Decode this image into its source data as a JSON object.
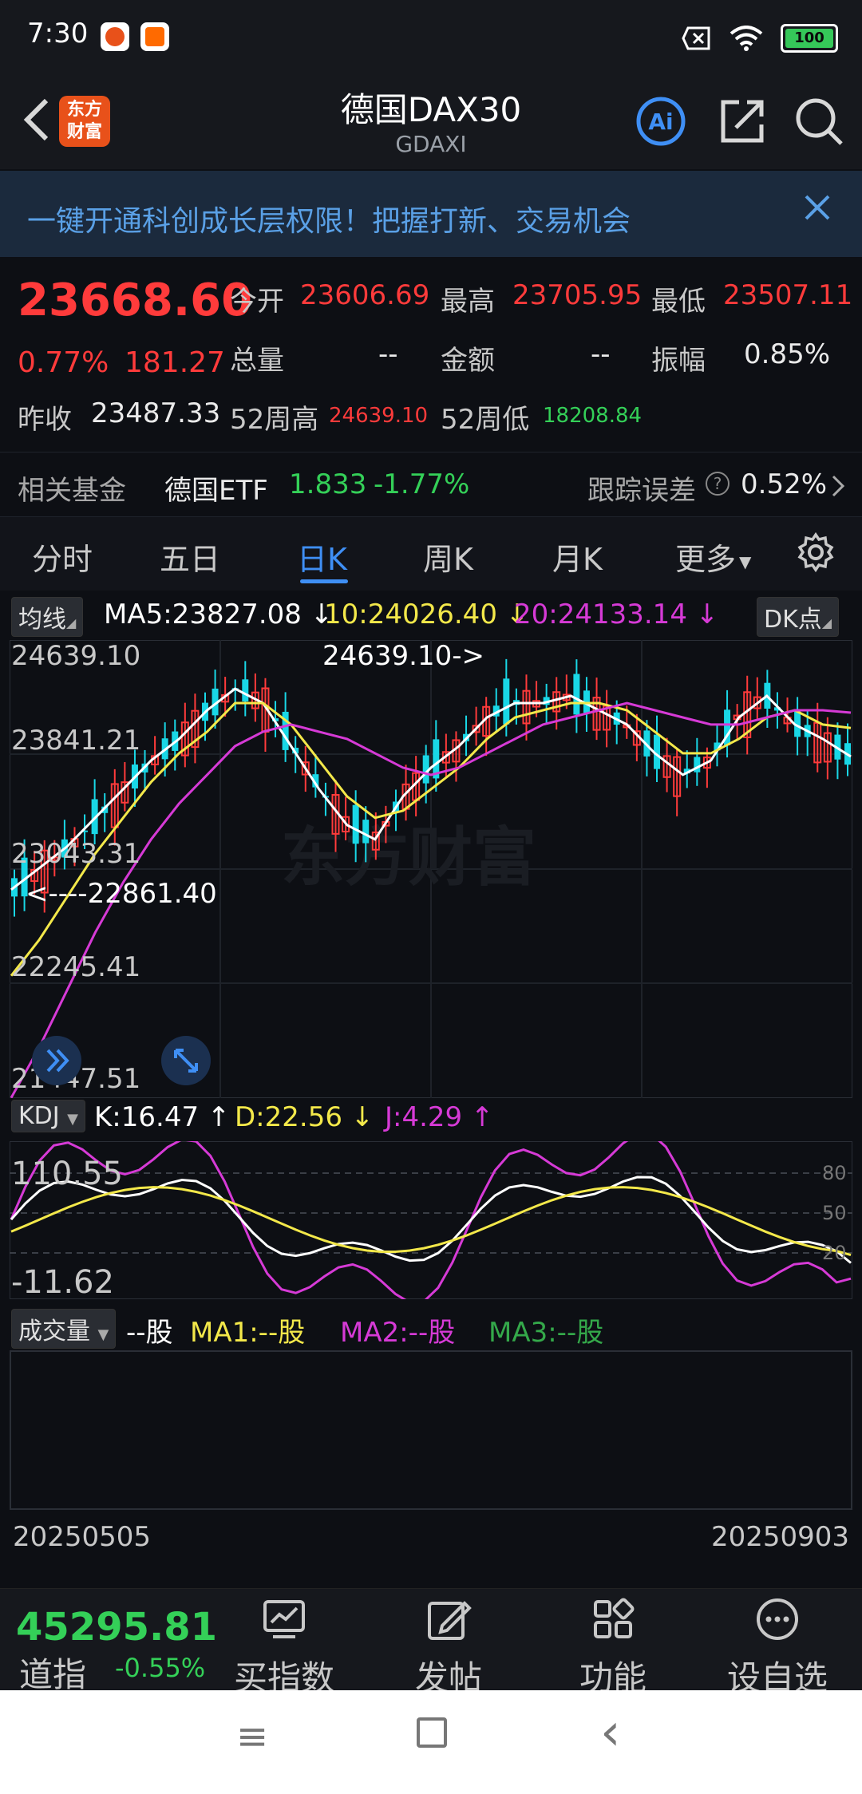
{
  "status": {
    "time": "7:30",
    "battery": "100"
  },
  "header": {
    "title": "德国DAX30",
    "subtitle": "GDAXI",
    "logo": "东方财富",
    "ai": "Ai"
  },
  "banner": {
    "text": "一键开通科创成长层权限！把握打新、交易机会"
  },
  "quote": {
    "price": "23668.60",
    "change_pct": "0.77%",
    "change": "181.27",
    "open_label": "今开",
    "open": "23606.69",
    "high_label": "最高",
    "high": "23705.95",
    "low_label": "最低",
    "low": "23507.11",
    "volume_label": "总量",
    "volume": "--",
    "amount_label": "金额",
    "amount": "--",
    "amplitude_label": "振幅",
    "amplitude": "0.85%",
    "prev_label": "昨收",
    "prev": "23487.33",
    "w52h_label": "52周高",
    "w52h": "24639.10",
    "w52l_label": "52周低",
    "w52l": "18208.84"
  },
  "fund": {
    "label": "相关基金",
    "name": "德国ETF",
    "price": "1.833",
    "change": "-1.77%",
    "track_label": "跟踪误差",
    "track": "0.52%"
  },
  "tabs": [
    "分时",
    "五日",
    "日K",
    "周K",
    "月K",
    "更多"
  ],
  "active_tab": 2,
  "kline": {
    "ma_btn": "均线",
    "ma5": "MA5:23827.08",
    "ma10": "10:24026.40",
    "ma20": "20:24133.14",
    "dk_btn": "DK点",
    "y_labels": [
      "24639.10",
      "23841.21",
      "23043.31",
      "22245.41",
      "21447.51"
    ],
    "max_marker": "24639.10->",
    "min_marker": "<----22861.40",
    "watermark": "东方财富"
  },
  "kdj": {
    "btn": "KDJ",
    "k": "K:16.47",
    "d": "D:22.56",
    "j": "J:4.29",
    "y_high": "110.55",
    "y_low": "-11.62",
    "levels": [
      "80",
      "50",
      "20"
    ]
  },
  "volume": {
    "btn": "成交量",
    "unit": "--股",
    "ma1": "MA1:--股",
    "ma2": "MA2:--股",
    "ma3": "MA3:--股",
    "date_start": "20250505",
    "date_end": "20250903"
  },
  "bottom": {
    "index_price": "45295.81",
    "index_name": "道指",
    "index_change": "-0.55%",
    "items": [
      "买指数",
      "发帖",
      "功能",
      "设自选"
    ]
  },
  "chart_data": {
    "type": "candlestick",
    "ylim": [
      21447.51,
      24639.1
    ],
    "yticks": [
      24639.1,
      23841.21,
      23043.31,
      22245.41,
      21447.51
    ],
    "x_range": [
      "20250505",
      "20250903"
    ],
    "high_marker": 24639.1,
    "low_marker": 22861.4,
    "series": [
      {
        "name": "MA5",
        "last": 23827.08,
        "values": [
          22900,
          23050,
          23200,
          23400,
          23600,
          23800,
          23950,
          24150,
          24300,
          24200,
          23900,
          23600,
          23350,
          23250,
          23550,
          23750,
          23900,
          24100,
          24200,
          24200,
          24250,
          24150,
          24050,
          23850,
          23700,
          23800,
          24100,
          24250,
          24050,
          23950,
          23827.08
        ]
      },
      {
        "name": "MA10",
        "last": 24026.4,
        "values": [
          22300,
          22550,
          22850,
          23150,
          23400,
          23650,
          23850,
          24000,
          24200,
          24200,
          24050,
          23800,
          23550,
          23400,
          23450,
          23600,
          23750,
          23950,
          24100,
          24150,
          24200,
          24200,
          24150,
          24000,
          23850,
          23850,
          23950,
          24100,
          24150,
          24050,
          24026.4
        ]
      },
      {
        "name": "MA20",
        "last": 24133.14,
        "values": [
          21450,
          21800,
          22200,
          22600,
          22950,
          23250,
          23500,
          23700,
          23900,
          24000,
          24050,
          24000,
          23950,
          23850,
          23750,
          23700,
          23750,
          23850,
          23950,
          24050,
          24100,
          24150,
          24200,
          24150,
          24100,
          24050,
          24050,
          24100,
          24150,
          24150,
          24133.14
        ]
      }
    ],
    "kdj": {
      "ylim": [
        -11.62,
        110.55
      ],
      "K": {
        "last": 16.47
      },
      "D": {
        "last": 22.56
      },
      "J": {
        "last": 4.29
      }
    }
  },
  "sysnav": {
    "menu": "≡",
    "home": "□",
    "back": "‹"
  }
}
